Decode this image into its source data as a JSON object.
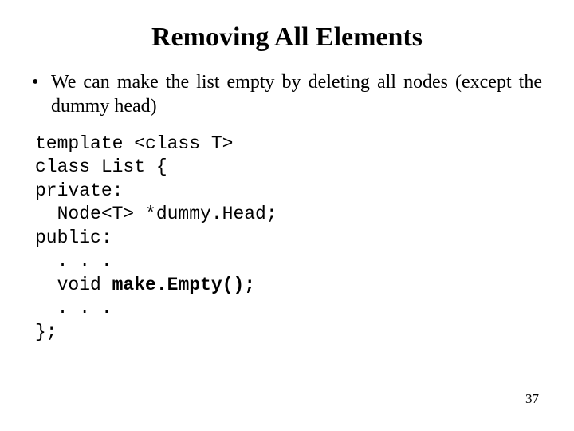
{
  "title": "Removing All Elements",
  "bullet": {
    "dot": "•",
    "text": "We can make the list empty by deleting all nodes (except the dummy head)"
  },
  "code": {
    "l1": "template <class T>",
    "l2": "class List {",
    "l3": "private:",
    "l4": "  Node<T> *dummy.Head;",
    "l5": "public:",
    "l6": "  . . .",
    "l7a": "  void ",
    "l7b": "make.Empty();",
    "l8": "  . . .",
    "l9": "};"
  },
  "page_number": "37"
}
